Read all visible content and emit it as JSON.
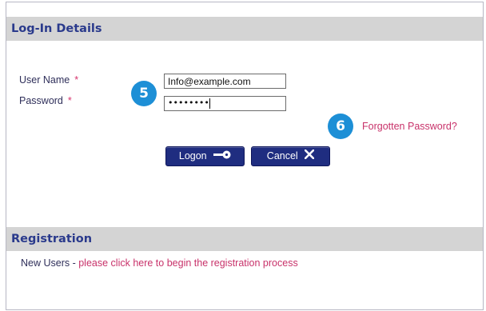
{
  "login": {
    "header": "Log-In Details",
    "username_label": "User Name",
    "password_label": "Password",
    "required_marker": "*",
    "username_value": "Info@example.com",
    "password_value": "••••••••",
    "forgot_link": "Forgotten Password?",
    "logon_button": "Logon",
    "cancel_button": "Cancel"
  },
  "badges": {
    "step5": "5",
    "step6": "6"
  },
  "registration": {
    "header": "Registration",
    "prefix": "New Users - ",
    "link": "please click here to begin the registration process"
  },
  "colors": {
    "header_bg": "#d4d4d4",
    "header_text": "#2a3a8c",
    "button_bg": "#1f2d80",
    "link": "#c8326a",
    "badge": "#1d8fd6"
  },
  "icons": {
    "logon": "key-icon",
    "cancel": "close-icon"
  }
}
